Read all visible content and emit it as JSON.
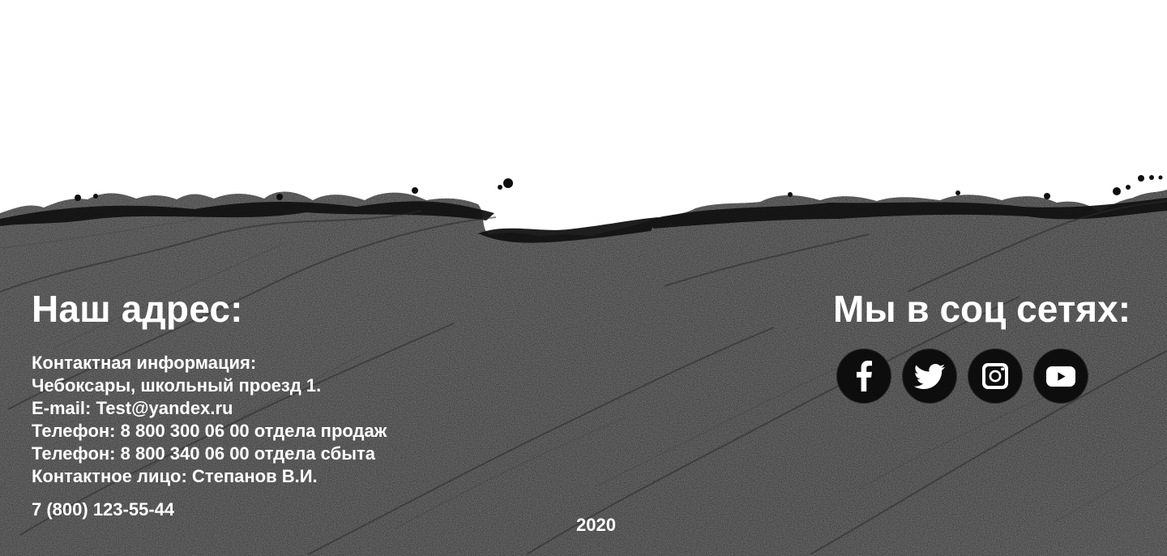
{
  "colors": {
    "page_background": "#ffffff",
    "footer_background": "#151515",
    "footer_text": "#ffffff",
    "icon_background": "#0d0d0d"
  },
  "address": {
    "title": "Наш адрес:",
    "lines": [
      "Контактная информация:",
      "Чебоксары, школьный проезд 1.",
      "E-mail: Test@yandex.ru",
      "Телефон: 8 800 300 06 00 отдела продаж",
      "Телефон: 8 800 340 06 00 отдела сбыта",
      "Контактное лицо: Степанов В.И."
    ],
    "phone": "7 (800) 123-55-44"
  },
  "social": {
    "title": "Мы в соц сетях:",
    "icons": [
      {
        "name": "facebook-icon",
        "icon": "facebook"
      },
      {
        "name": "twitter-icon",
        "icon": "twitter"
      },
      {
        "name": "instagram-icon",
        "icon": "instagram"
      },
      {
        "name": "youtube-icon",
        "icon": "youtube"
      }
    ]
  },
  "footer": {
    "year": "2020"
  }
}
